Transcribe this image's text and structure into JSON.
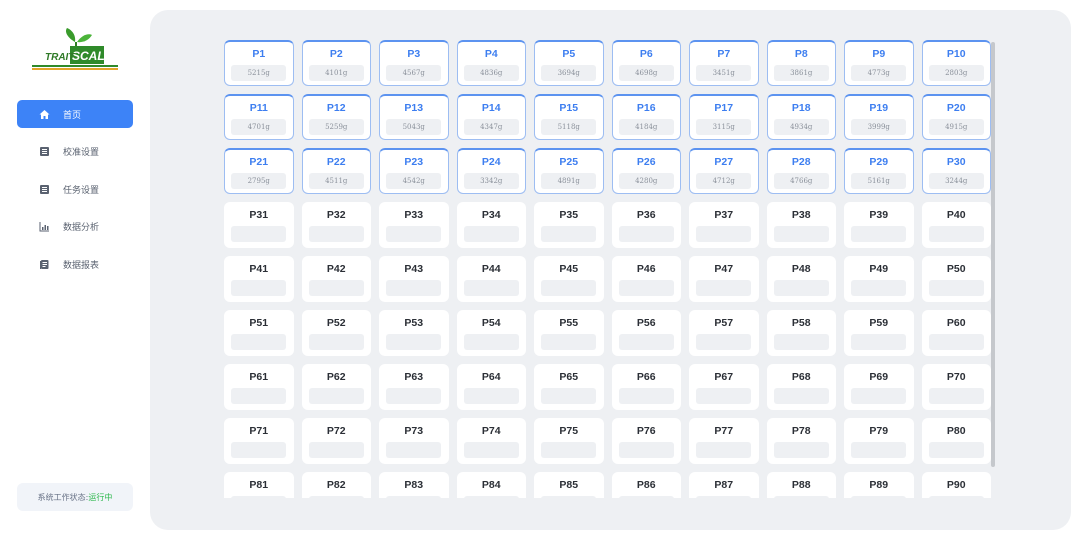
{
  "logo": {
    "text_left": "TRAIT",
    "text_right": "SCALE"
  },
  "nav": [
    {
      "label": "首页",
      "icon": "home-icon",
      "active": true
    },
    {
      "label": "校准设置",
      "icon": "document-icon",
      "active": false
    },
    {
      "label": "任务设置",
      "icon": "document-icon",
      "active": false
    },
    {
      "label": "数据分析",
      "icon": "bar-chart-icon",
      "active": false
    },
    {
      "label": "数据报表",
      "icon": "report-icon",
      "active": false
    }
  ],
  "status": {
    "label": "系统工作状态:",
    "value": "运行中",
    "value_color": "#2db84d"
  },
  "colors": {
    "accent": "#3d83f7",
    "filled_border": "#5c93f0"
  },
  "plots": [
    {
      "id": "P1",
      "weight": "5215g"
    },
    {
      "id": "P2",
      "weight": "4101g"
    },
    {
      "id": "P3",
      "weight": "4567g"
    },
    {
      "id": "P4",
      "weight": "4836g"
    },
    {
      "id": "P5",
      "weight": "3694g"
    },
    {
      "id": "P6",
      "weight": "4698g"
    },
    {
      "id": "P7",
      "weight": "3451g"
    },
    {
      "id": "P8",
      "weight": "3861g"
    },
    {
      "id": "P9",
      "weight": "4773g"
    },
    {
      "id": "P10",
      "weight": "2803g"
    },
    {
      "id": "P11",
      "weight": "4701g"
    },
    {
      "id": "P12",
      "weight": "5259g"
    },
    {
      "id": "P13",
      "weight": "5043g"
    },
    {
      "id": "P14",
      "weight": "4347g"
    },
    {
      "id": "P15",
      "weight": "5118g"
    },
    {
      "id": "P16",
      "weight": "4184g"
    },
    {
      "id": "P17",
      "weight": "3115g"
    },
    {
      "id": "P18",
      "weight": "4934g"
    },
    {
      "id": "P19",
      "weight": "3999g"
    },
    {
      "id": "P20",
      "weight": "4915g"
    },
    {
      "id": "P21",
      "weight": "2795g"
    },
    {
      "id": "P22",
      "weight": "4511g"
    },
    {
      "id": "P23",
      "weight": "4542g"
    },
    {
      "id": "P24",
      "weight": "3342g"
    },
    {
      "id": "P25",
      "weight": "4891g"
    },
    {
      "id": "P26",
      "weight": "4280g"
    },
    {
      "id": "P27",
      "weight": "4712g"
    },
    {
      "id": "P28",
      "weight": "4766g"
    },
    {
      "id": "P29",
      "weight": "5161g"
    },
    {
      "id": "P30",
      "weight": "3244g"
    },
    {
      "id": "P31",
      "weight": ""
    },
    {
      "id": "P32",
      "weight": ""
    },
    {
      "id": "P33",
      "weight": ""
    },
    {
      "id": "P34",
      "weight": ""
    },
    {
      "id": "P35",
      "weight": ""
    },
    {
      "id": "P36",
      "weight": ""
    },
    {
      "id": "P37",
      "weight": ""
    },
    {
      "id": "P38",
      "weight": ""
    },
    {
      "id": "P39",
      "weight": ""
    },
    {
      "id": "P40",
      "weight": ""
    },
    {
      "id": "P41",
      "weight": ""
    },
    {
      "id": "P42",
      "weight": ""
    },
    {
      "id": "P43",
      "weight": ""
    },
    {
      "id": "P44",
      "weight": ""
    },
    {
      "id": "P45",
      "weight": ""
    },
    {
      "id": "P46",
      "weight": ""
    },
    {
      "id": "P47",
      "weight": ""
    },
    {
      "id": "P48",
      "weight": ""
    },
    {
      "id": "P49",
      "weight": ""
    },
    {
      "id": "P50",
      "weight": ""
    },
    {
      "id": "P51",
      "weight": ""
    },
    {
      "id": "P52",
      "weight": ""
    },
    {
      "id": "P53",
      "weight": ""
    },
    {
      "id": "P54",
      "weight": ""
    },
    {
      "id": "P55",
      "weight": ""
    },
    {
      "id": "P56",
      "weight": ""
    },
    {
      "id": "P57",
      "weight": ""
    },
    {
      "id": "P58",
      "weight": ""
    },
    {
      "id": "P59",
      "weight": ""
    },
    {
      "id": "P60",
      "weight": ""
    },
    {
      "id": "P61",
      "weight": ""
    },
    {
      "id": "P62",
      "weight": ""
    },
    {
      "id": "P63",
      "weight": ""
    },
    {
      "id": "P64",
      "weight": ""
    },
    {
      "id": "P65",
      "weight": ""
    },
    {
      "id": "P66",
      "weight": ""
    },
    {
      "id": "P67",
      "weight": ""
    },
    {
      "id": "P68",
      "weight": ""
    },
    {
      "id": "P69",
      "weight": ""
    },
    {
      "id": "P70",
      "weight": ""
    },
    {
      "id": "P71",
      "weight": ""
    },
    {
      "id": "P72",
      "weight": ""
    },
    {
      "id": "P73",
      "weight": ""
    },
    {
      "id": "P74",
      "weight": ""
    },
    {
      "id": "P75",
      "weight": ""
    },
    {
      "id": "P76",
      "weight": ""
    },
    {
      "id": "P77",
      "weight": ""
    },
    {
      "id": "P78",
      "weight": ""
    },
    {
      "id": "P79",
      "weight": ""
    },
    {
      "id": "P80",
      "weight": ""
    },
    {
      "id": "P81",
      "weight": ""
    },
    {
      "id": "P82",
      "weight": ""
    },
    {
      "id": "P83",
      "weight": ""
    },
    {
      "id": "P84",
      "weight": ""
    },
    {
      "id": "P85",
      "weight": ""
    },
    {
      "id": "P86",
      "weight": ""
    },
    {
      "id": "P87",
      "weight": ""
    },
    {
      "id": "P88",
      "weight": ""
    },
    {
      "id": "P89",
      "weight": ""
    },
    {
      "id": "P90",
      "weight": ""
    }
  ]
}
